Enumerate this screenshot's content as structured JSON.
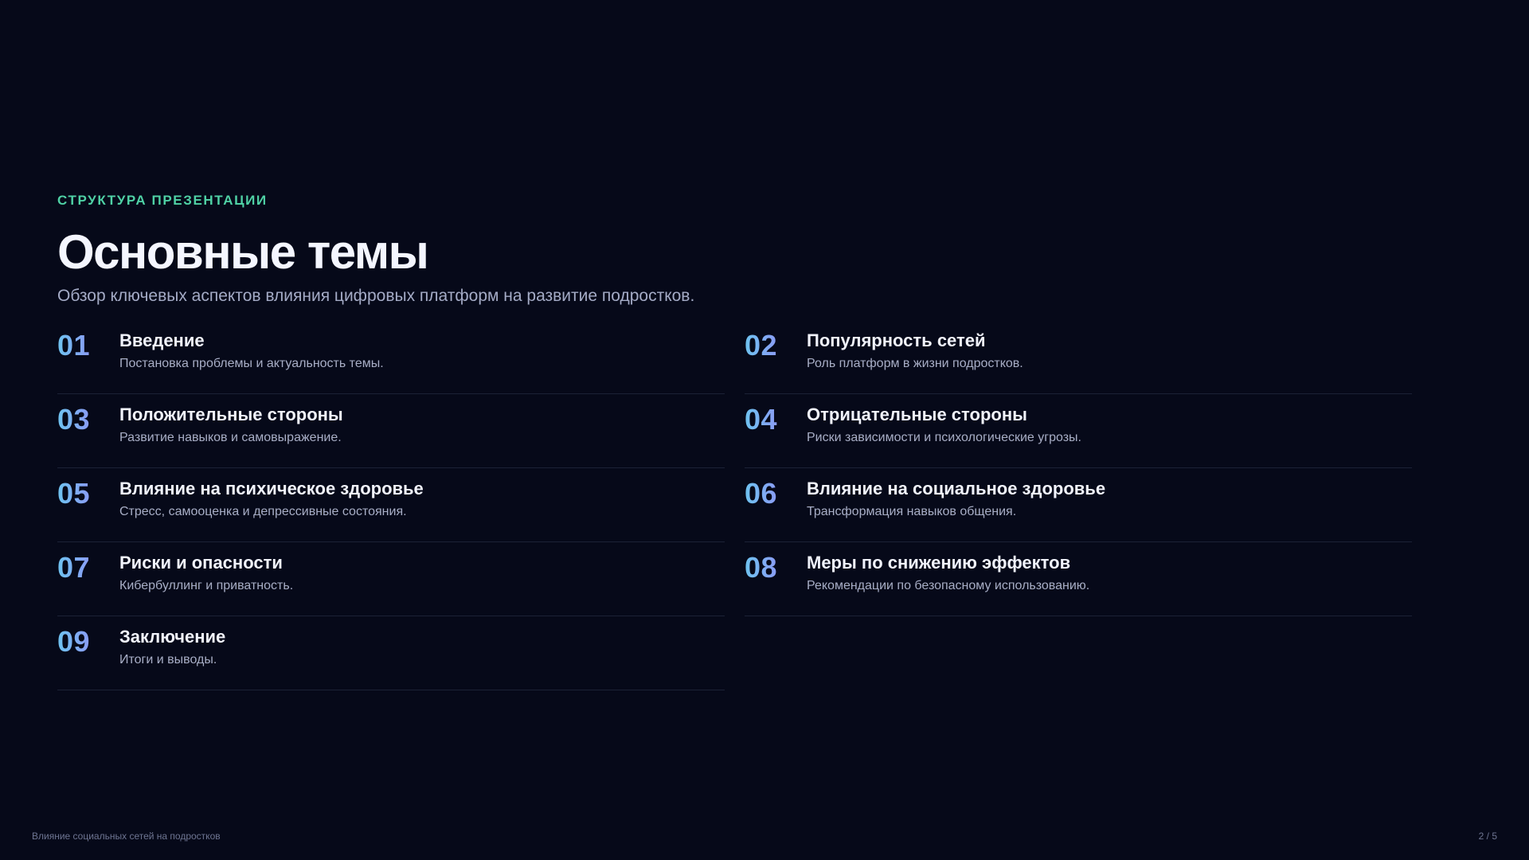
{
  "header": {
    "eyebrow": "СТРУКТУРА ПРЕЗЕНТАЦИИ",
    "title": "Основные темы",
    "subtitle": "Обзор ключевых аспектов влияния цифровых платформ на развитие подростков."
  },
  "topics": [
    {
      "number": "01",
      "title": "Введение",
      "description": "Постановка проблемы и актуальность темы."
    },
    {
      "number": "02",
      "title": "Популярность сетей",
      "description": "Роль платформ в жизни подростков."
    },
    {
      "number": "03",
      "title": "Положительные стороны",
      "description": "Развитие навыков и самовыражение."
    },
    {
      "number": "04",
      "title": "Отрицательные стороны",
      "description": "Риски зависимости и психологические угрозы."
    },
    {
      "number": "05",
      "title": "Влияние на психическое здоровье",
      "description": "Стресс, самооценка и депрессивные состояния."
    },
    {
      "number": "06",
      "title": "Влияние на социальное здоровье",
      "description": "Трансформация навыков общения."
    },
    {
      "number": "07",
      "title": "Риски и опасности",
      "description": "Кибербуллинг и приватность."
    },
    {
      "number": "08",
      "title": "Меры по снижению эффектов",
      "description": "Рекомендации по безопасному использованию."
    },
    {
      "number": "09",
      "title": "Заключение",
      "description": "Итоги и выводы."
    }
  ],
  "footer": {
    "presentation_title": "Влияние социальных сетей на подростков",
    "page_indicator": "2 / 5"
  },
  "colors": {
    "background": "#060919",
    "accent_eyebrow": "#4fd1a5",
    "number_gradient_start": "#6ec3f0",
    "number_gradient_end": "#8a9cf5"
  }
}
